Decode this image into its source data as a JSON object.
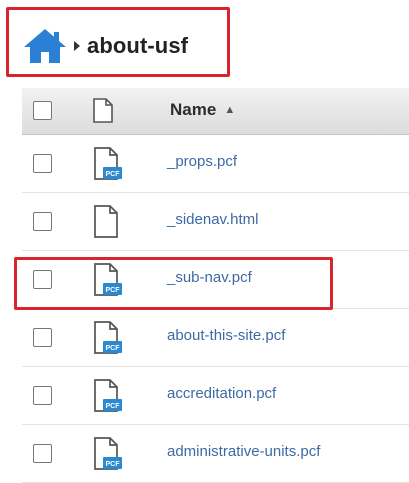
{
  "breadcrumb": {
    "home_icon": "home-icon",
    "separator_icon": "caret-right-icon",
    "current": "about-usf"
  },
  "table": {
    "header": {
      "select_all_icon": "checkbox-icon",
      "type_icon": "file-icon",
      "name_label": "Name",
      "sort_icon": "▲"
    },
    "rows": [
      {
        "name": "_props.pcf",
        "icon": "pcf-file-icon",
        "badge": "PCF"
      },
      {
        "name": "_sidenav.html",
        "icon": "file-icon",
        "badge": ""
      },
      {
        "name": "_sub-nav.pcf",
        "icon": "pcf-file-icon",
        "badge": "PCF"
      },
      {
        "name": "about-this-site.pcf",
        "icon": "pcf-file-icon",
        "badge": "PCF"
      },
      {
        "name": "accreditation.pcf",
        "icon": "pcf-file-icon",
        "badge": "PCF"
      },
      {
        "name": "administrative-units.pcf",
        "icon": "pcf-file-icon",
        "badge": "PCF"
      }
    ]
  },
  "colors": {
    "highlight": "#d9232e",
    "link": "#3d6aa6",
    "home_icon": "#2b80d6",
    "pcf_badge": "#2a89d0"
  }
}
